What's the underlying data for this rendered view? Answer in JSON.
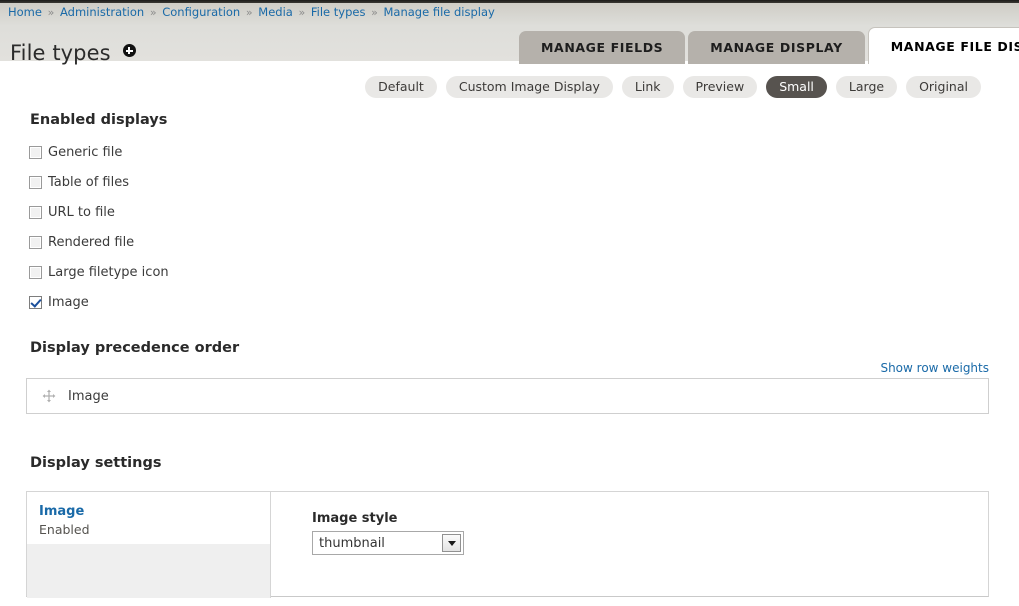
{
  "breadcrumb": {
    "separator": "»",
    "items": [
      "Home",
      "Administration",
      "Configuration",
      "Media",
      "File types",
      "Manage file display"
    ]
  },
  "header": {
    "title": "File types"
  },
  "primary_tabs": [
    {
      "label": "MANAGE FIELDS",
      "active": false
    },
    {
      "label": "MANAGE DISPLAY",
      "active": false
    },
    {
      "label": "MANAGE FILE DISPLAY",
      "active": true
    }
  ],
  "view_modes": [
    {
      "label": "Default",
      "active": false
    },
    {
      "label": "Custom Image Display",
      "active": false
    },
    {
      "label": "Link",
      "active": false
    },
    {
      "label": "Preview",
      "active": false
    },
    {
      "label": "Small",
      "active": true
    },
    {
      "label": "Large",
      "active": false
    },
    {
      "label": "Original",
      "active": false
    }
  ],
  "enabled_displays": {
    "title": "Enabled displays",
    "items": [
      {
        "label": "Generic file",
        "checked": false
      },
      {
        "label": "Table of files",
        "checked": false
      },
      {
        "label": "URL to file",
        "checked": false
      },
      {
        "label": "Rendered file",
        "checked": false
      },
      {
        "label": "Large filetype icon",
        "checked": false
      },
      {
        "label": "Image",
        "checked": true
      }
    ]
  },
  "precedence": {
    "title": "Display precedence order",
    "show_row_weights": "Show row weights",
    "rows": [
      {
        "label": "Image"
      }
    ]
  },
  "display_settings": {
    "title": "Display settings",
    "plugin_name": "Image",
    "plugin_state": "Enabled",
    "field_label": "Image style",
    "selected_style": "thumbnail"
  },
  "colors": {
    "link": "#1a6aa8",
    "active_pill_bg": "#57534f",
    "tab_bg": "#b5b1ab",
    "header_band": "#dededa"
  }
}
